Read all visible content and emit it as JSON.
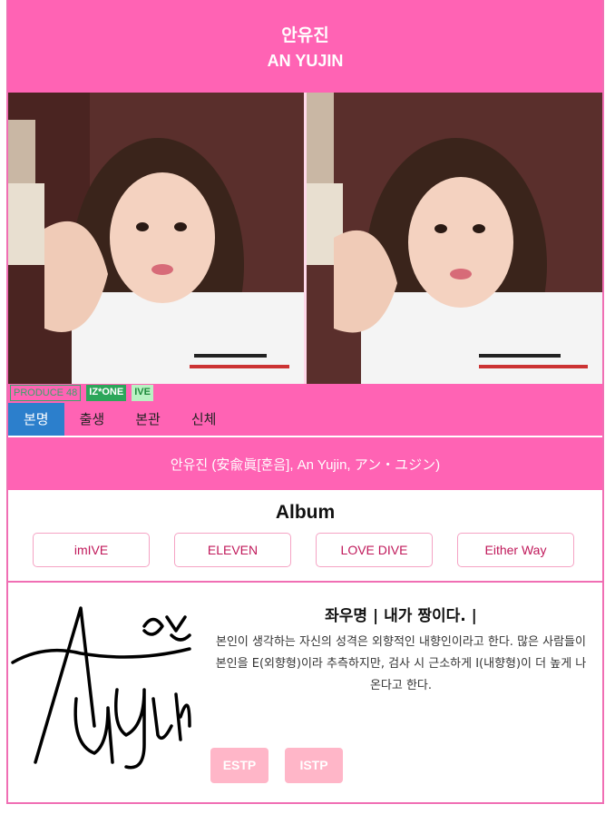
{
  "header": {
    "name_kr": "안유진",
    "name_en": "AN YUJIN"
  },
  "badges": [
    "PRODUCE 48",
    "IZ*ONE",
    "IVE"
  ],
  "tabs": [
    "본명",
    "출생",
    "본관",
    "신체"
  ],
  "full_name": "안유진 (安兪眞[훈음], An Yujin, アン・ユジン)",
  "album": {
    "title": "Album",
    "items": [
      "imIVE",
      "ELEVEN",
      "LOVE DIVE",
      "Either Way"
    ]
  },
  "profile": {
    "motto": "좌우명 | 내가 짱이다. |",
    "description": "본인이 생각하는 자신의 성격은 외향적인 내향인이라고 한다. 많은 사람들이 본인을 E(외향형)이라 추측하지만, 검사 시 근소하게 I(내향형)이 더 높게 나온다고 한다.",
    "mbti": [
      "ESTP",
      "ISTP"
    ],
    "signature_text": "An Yujin 유진"
  },
  "colors": {
    "brand_pink": "#ff63b4",
    "tab_active": "#2c7fcc",
    "mbti_bg": "#ffb6c8"
  }
}
